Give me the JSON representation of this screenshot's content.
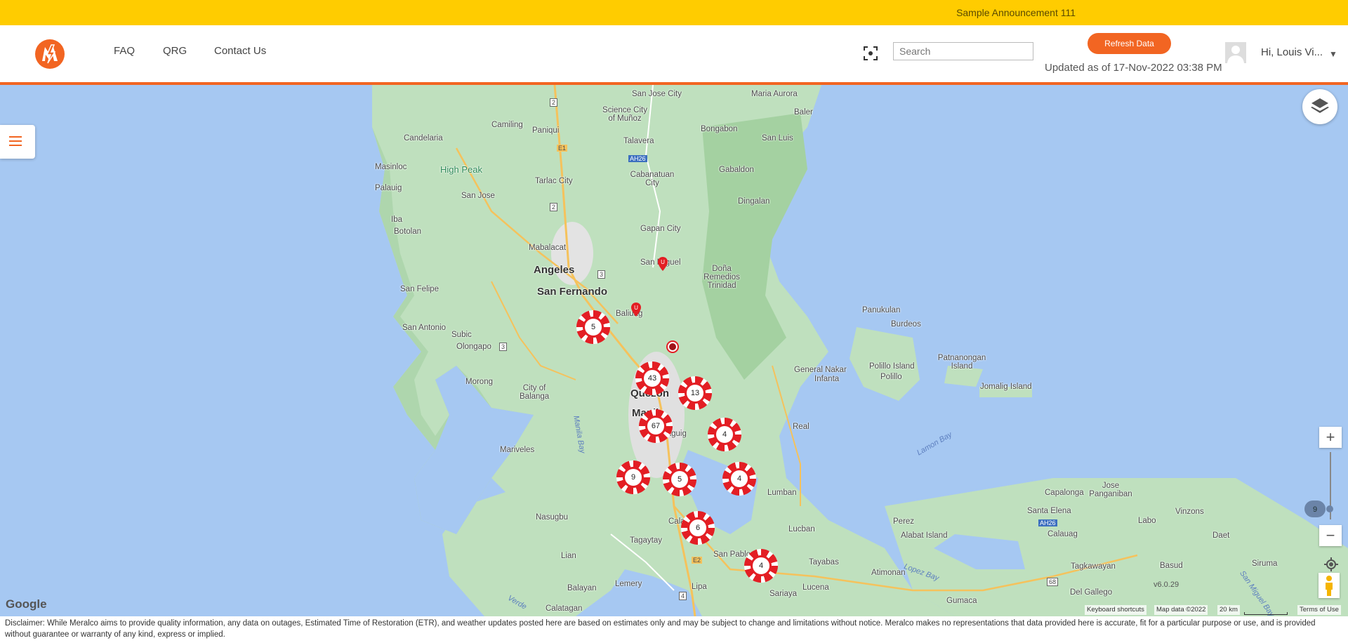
{
  "announcement": "Sample Announcement 111",
  "header": {
    "nav": [
      "FAQ",
      "QRG",
      "Contact Us"
    ],
    "search_placeholder": "Search",
    "refresh_label": "Refresh Data",
    "updated_text": "Updated as of 17-Nov-2022 03:38 PM",
    "user_greeting": "Hi, Louis Vi...",
    "brand_color": "#f26522",
    "announcement_color": "#ffcc00"
  },
  "map": {
    "place_labels": [
      "San Jose City",
      "Maria Aurora",
      "Baler",
      "Camiling",
      "Paniqui",
      "Science City of Muñoz",
      "Bongabon",
      "San Luis",
      "Candelaria",
      "Talavera",
      "Masinloc",
      "High Peak",
      "Palauig",
      "Tarlac City",
      "Cabanatuan City",
      "Gabaldon",
      "San Jose",
      "Dingalan",
      "Iba",
      "Botolan",
      "Gapan City",
      "Mabalacat",
      "Angeles",
      "San Miguel",
      "Doña Remedios Trinidad",
      "San Felipe",
      "San Fernando",
      "Baliuag",
      "Panukulan",
      "San Antonio",
      "Subic",
      "Burdeos",
      "Olongapo",
      "General Nakar",
      "Infanta",
      "Polillo Island",
      "Polillo",
      "Patnanongan Island",
      "Morong",
      "City of Balanga",
      "Quezon",
      "Manila",
      "Jomalig Island",
      "Manila Bay",
      "Taguig",
      "Real",
      "Mariveles",
      "Lamon Bay",
      "Nasugbu",
      "Tagaytay",
      "Calamba",
      "Lumban",
      "Capalonga",
      "Jose Panganiban",
      "Santa Elena",
      "Vinzons",
      "Perez",
      "Labo",
      "Lucban",
      "Alabat Island",
      "Daet",
      "Calauag",
      "Lian",
      "San Pablo",
      "Tayabas",
      "Atimonan",
      "Tagkawayan",
      "Basud",
      "Siruma",
      "Balayan",
      "Lemery",
      "Lipa",
      "Sariaya",
      "Lucena",
      "Gumaca",
      "Del Gallego",
      "Calatagan",
      "Lopez Bay",
      "Verde",
      "San Miguel Bay"
    ],
    "road_shields": [
      "2",
      "E1",
      "AH26",
      "2",
      "3",
      "3",
      "E2",
      "4",
      "AH26",
      "68"
    ],
    "clusters": [
      5,
      43,
      13,
      67,
      4,
      9,
      5,
      4,
      6,
      4
    ],
    "zoom_level": "9",
    "controls": {
      "zoom_in": "+",
      "zoom_out": "−"
    },
    "google_logo": "Google",
    "version": "v6.0.29",
    "attribution": {
      "shortcuts": "Keyboard shortcuts",
      "data": "Map data ©2022",
      "scale": "20 km",
      "terms": "Terms of Use"
    },
    "icons": [
      "hamburger-menu-icon",
      "layers-icon",
      "scan-icon",
      "my-location-icon",
      "pegman-icon",
      "outage-pin-icon"
    ]
  },
  "disclaimer": "Disclaimer: While Meralco aims to provide quality information, any data on outages, Estimated Time of Restoration (ETR), and weather updates posted here are based on estimates only and may be subject to change and limitations without notice. Meralco makes no representations that data provided here is accurate, fit for a particular purpose or use, and is provided without guarantee or warranty of any kind, express or implied."
}
